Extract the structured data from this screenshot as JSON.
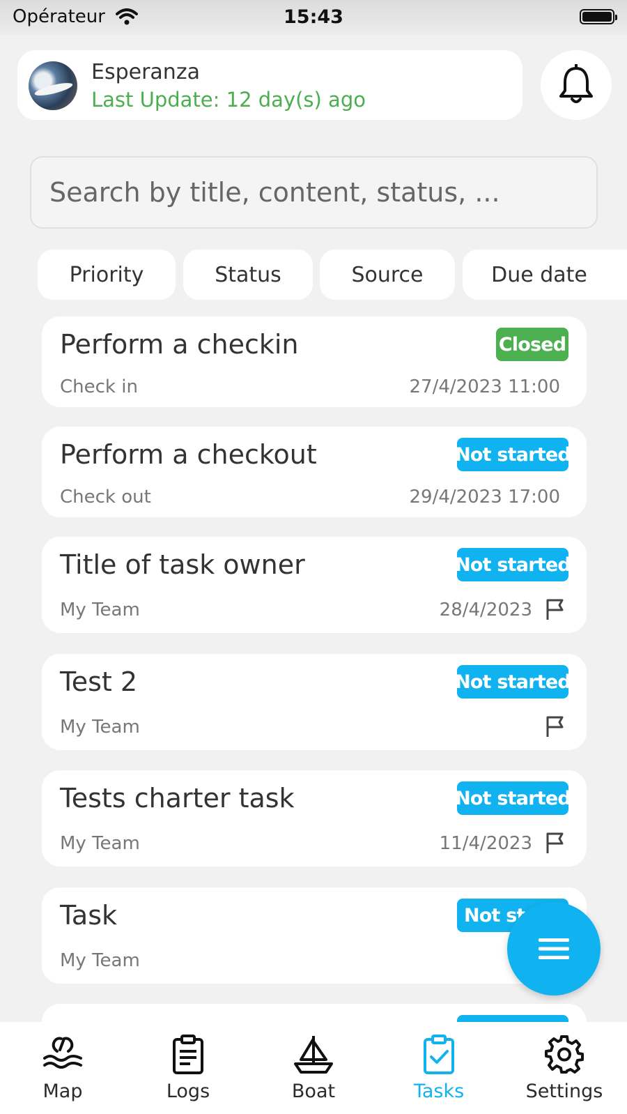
{
  "status_bar": {
    "carrier": "Opérateur",
    "time": "15:43"
  },
  "header": {
    "boat_name": "Esperanza",
    "last_update": "Last Update: 12 day(s) ago"
  },
  "search": {
    "placeholder": "Search by title, content, status, ..."
  },
  "filters": [
    "Priority",
    "Status",
    "Source",
    "Due date"
  ],
  "tasks": [
    {
      "title": "Perform a checkin",
      "subtitle": "Check in",
      "date": "27/4/2023 11:00",
      "status": "Closed",
      "flag": false
    },
    {
      "title": "Perform a checkout",
      "subtitle": "Check out",
      "date": "29/4/2023 17:00",
      "status": "Not started",
      "flag": false
    },
    {
      "title": "Title of task owner",
      "subtitle": "My Team",
      "date": "28/4/2023",
      "status": "Not started",
      "flag": true
    },
    {
      "title": "Test 2",
      "subtitle": "My Team",
      "date": "",
      "status": "Not started",
      "flag": true
    },
    {
      "title": "Tests charter task",
      "subtitle": "My Team",
      "date": "11/4/2023",
      "status": "Not started",
      "flag": true
    },
    {
      "title": "Task",
      "subtitle": "My Team",
      "date": "",
      "status": "Not st",
      "flag": false
    }
  ],
  "colors": {
    "closed": "#4caf50",
    "not_started": "#10b3ef",
    "accent": "#10b3ef",
    "update_green": "#4cae4f"
  },
  "tabs": [
    {
      "label": "Map",
      "icon": "map-icon",
      "active": false
    },
    {
      "label": "Logs",
      "icon": "logs-icon",
      "active": false
    },
    {
      "label": "Boat",
      "icon": "boat-icon",
      "active": false
    },
    {
      "label": "Tasks",
      "icon": "tasks-icon",
      "active": true
    },
    {
      "label": "Settings",
      "icon": "settings-icon",
      "active": false
    }
  ]
}
